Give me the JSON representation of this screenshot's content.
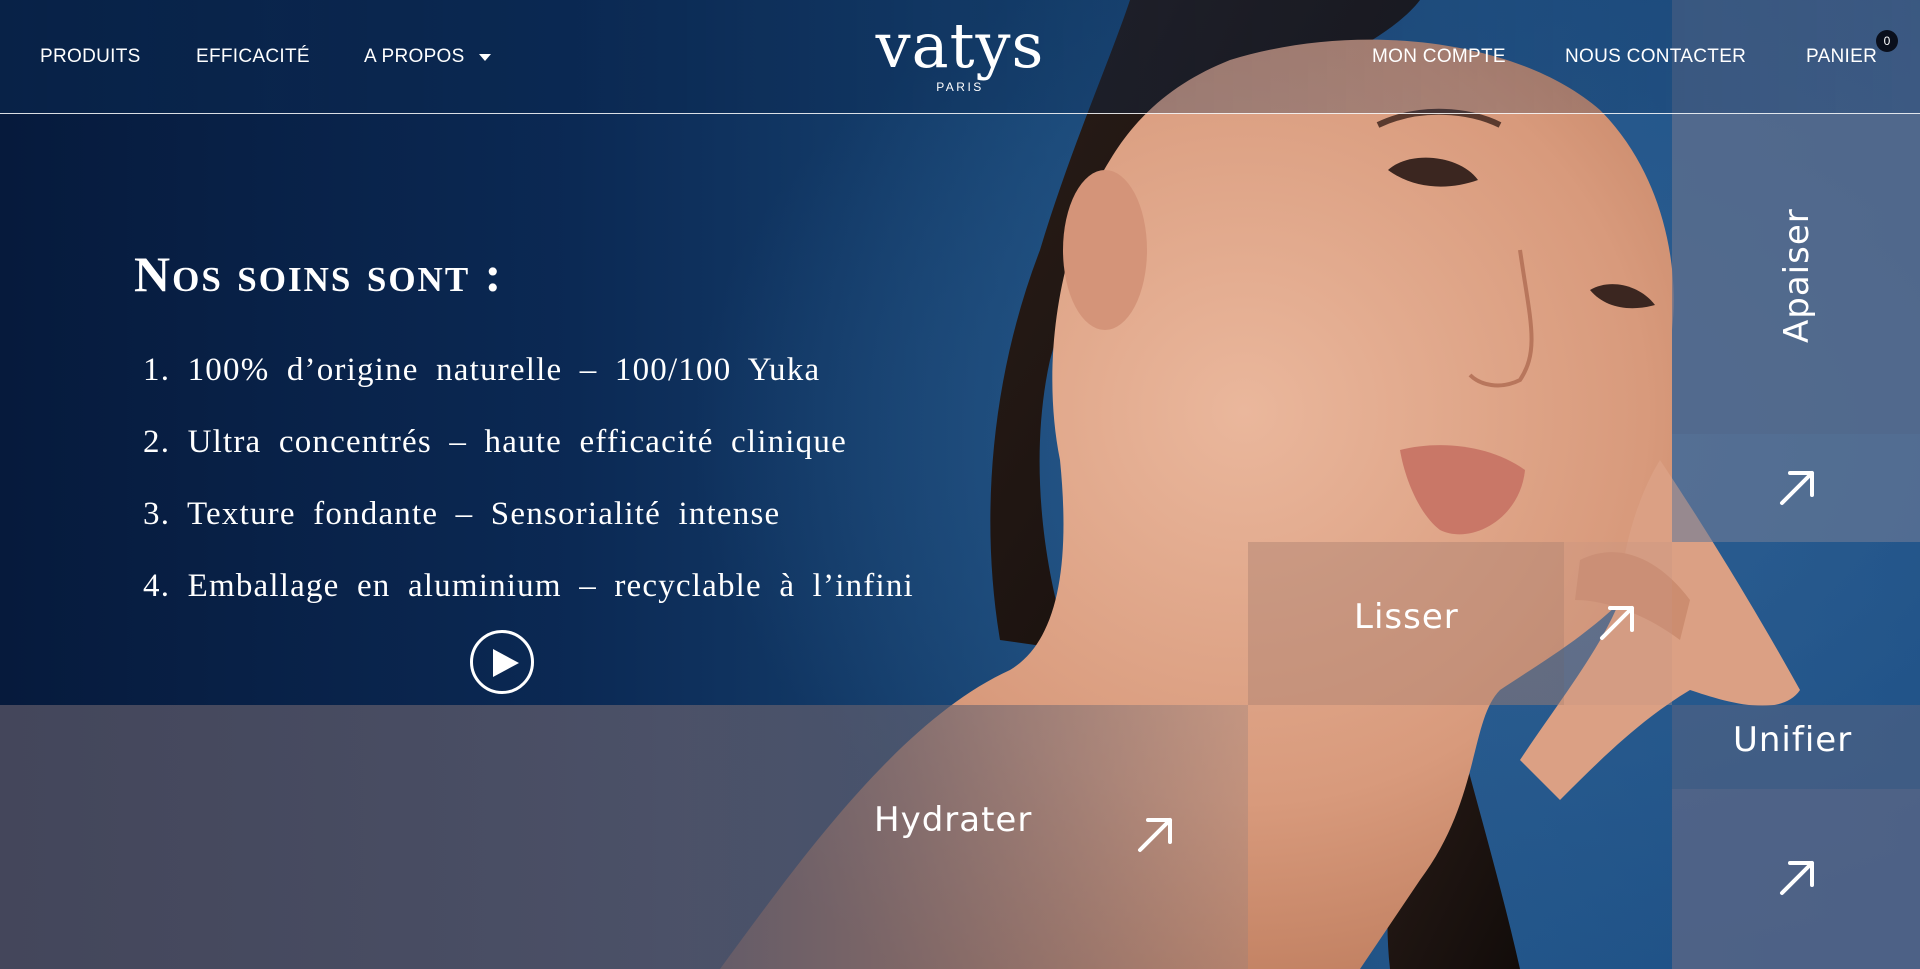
{
  "header": {
    "nav_left": {
      "produits": "PRODUITS",
      "efficacite": "EFFICACITÉ",
      "apropos": "A PROPOS"
    },
    "logo": {
      "word": "vatys",
      "sub": "PARIS"
    },
    "nav_right": {
      "compte": "MON COMPTE",
      "contact": "NOUS CONTACTER",
      "panier": "PANIER",
      "cart_count": "0"
    }
  },
  "hero": {
    "title": "Nos soins sont :",
    "items": [
      "1. 100% d’origine naturelle – 100/100 Yuka",
      "2. Ultra concentrés – haute efficacité clinique",
      "3. Texture fondante – Sensorialité intense",
      "4. Emballage en aluminium – recyclable à l’infini"
    ],
    "play_icon": "play-circle-icon"
  },
  "tiles": {
    "hydrater": "Hydrater",
    "lisser": "Lisser",
    "apaiser": "Apaiser",
    "unifier": "Unifier",
    "arrow_icon": "arrow-up-right-icon"
  },
  "colors": {
    "background_dark": "#061a3c",
    "background_blue": "#23568a",
    "tile_grey": "#54566a",
    "tile_blue": "#62708e",
    "text": "#ffffff"
  }
}
